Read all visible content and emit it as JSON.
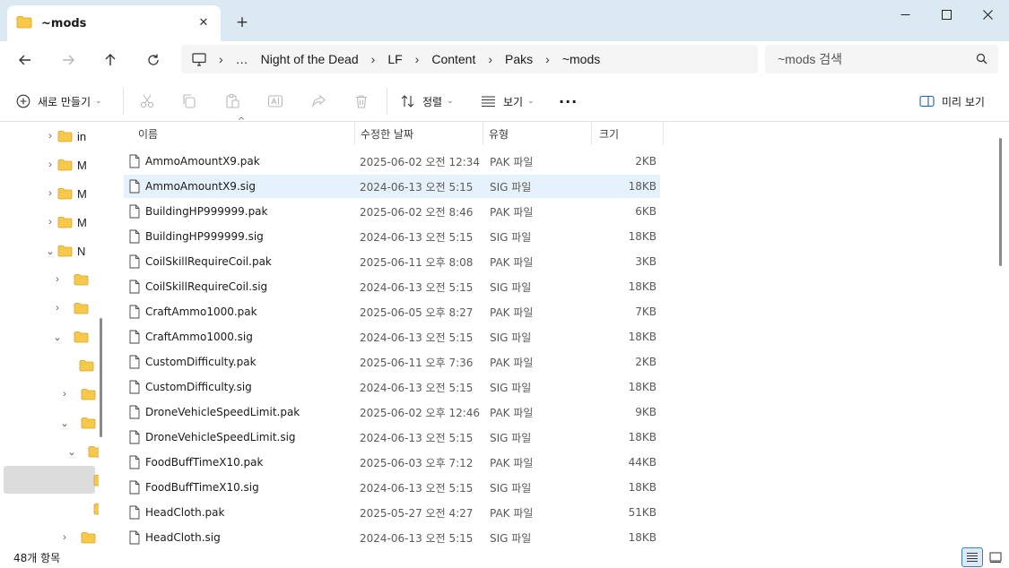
{
  "window": {
    "tab_title": "~mods",
    "new_tab": "+",
    "minimize": "—",
    "maximize": "☐",
    "close": "✕"
  },
  "address": {
    "crumbs": [
      "…",
      "Night of the Dead",
      "LF",
      "Content",
      "Paks",
      "~mods"
    ],
    "search_placeholder": "~mods 검색"
  },
  "toolbar": {
    "new_label": "새로 만들기",
    "sort_label": "정렬",
    "view_label": "보기",
    "more_label": "···",
    "preview_label": "미리 보기"
  },
  "nav_tree": [
    {
      "label": "in",
      "chevron": "›"
    },
    {
      "label": "M",
      "chevron": "›"
    },
    {
      "label": "M",
      "chevron": "›"
    },
    {
      "label": "M",
      "chevron": "›"
    },
    {
      "label": "N",
      "chevron": "⌄"
    },
    {
      "label": "",
      "chevron": "›"
    },
    {
      "label": "",
      "chevron": "›"
    },
    {
      "label": "",
      "chevron": "⌄"
    },
    {
      "label": "",
      "chevron": ""
    },
    {
      "label": "",
      "chevron": "›"
    },
    {
      "label": "",
      "chevron": "⌄"
    },
    {
      "label": "",
      "chevron": "⌄"
    },
    {
      "label": "",
      "chevron": ""
    },
    {
      "label": "",
      "chevron": ""
    },
    {
      "label": "",
      "chevron": "›"
    }
  ],
  "columns": {
    "name": "이름",
    "date": "수정한 날짜",
    "type": "유형",
    "size": "크기"
  },
  "files": [
    {
      "name": "AmmoAmountX9.pak",
      "date": "2025-06-02 오전 12:34",
      "type": "PAK 파일",
      "size": "2KB"
    },
    {
      "name": "AmmoAmountX9.sig",
      "date": "2024-06-13 오전 5:15",
      "type": "SIG 파일",
      "size": "18KB"
    },
    {
      "name": "BuildingHP999999.pak",
      "date": "2025-06-02 오전 8:46",
      "type": "PAK 파일",
      "size": "6KB"
    },
    {
      "name": "BuildingHP999999.sig",
      "date": "2024-06-13 오전 5:15",
      "type": "SIG 파일",
      "size": "18KB"
    },
    {
      "name": "CoilSkillRequireCoil.pak",
      "date": "2025-06-11 오후 8:08",
      "type": "PAK 파일",
      "size": "3KB"
    },
    {
      "name": "CoilSkillRequireCoil.sig",
      "date": "2024-06-13 오전 5:15",
      "type": "SIG 파일",
      "size": "18KB"
    },
    {
      "name": "CraftAmmo1000.pak",
      "date": "2025-06-05 오후 8:27",
      "type": "PAK 파일",
      "size": "7KB"
    },
    {
      "name": "CraftAmmo1000.sig",
      "date": "2024-06-13 오전 5:15",
      "type": "SIG 파일",
      "size": "18KB"
    },
    {
      "name": "CustomDifficulty.pak",
      "date": "2025-06-11 오후 7:36",
      "type": "PAK 파일",
      "size": "2KB"
    },
    {
      "name": "CustomDifficulty.sig",
      "date": "2024-06-13 오전 5:15",
      "type": "SIG 파일",
      "size": "18KB"
    },
    {
      "name": "DroneVehicleSpeedLimit.pak",
      "date": "2025-06-02 오후 12:46",
      "type": "PAK 파일",
      "size": "9KB"
    },
    {
      "name": "DroneVehicleSpeedLimit.sig",
      "date": "2024-06-13 오전 5:15",
      "type": "SIG 파일",
      "size": "18KB"
    },
    {
      "name": "FoodBuffTimeX10.pak",
      "date": "2025-06-03 오후 7:12",
      "type": "PAK 파일",
      "size": "44KB"
    },
    {
      "name": "FoodBuffTimeX10.sig",
      "date": "2024-06-13 오전 5:15",
      "type": "SIG 파일",
      "size": "18KB"
    },
    {
      "name": "HeadCloth.pak",
      "date": "2025-05-27 오전 4:27",
      "type": "PAK 파일",
      "size": "51KB"
    },
    {
      "name": "HeadCloth.sig",
      "date": "2024-06-13 오전 5:15",
      "type": "SIG 파일",
      "size": "18KB"
    }
  ],
  "selected_file": "AmmoAmountX9.sig",
  "status": {
    "item_count": "48개 항목"
  },
  "colors": {
    "titlebar": "#dbe9f2",
    "folder": "#f6c94a",
    "selection": "#e5f1fb",
    "accent": "#3c7fb1"
  }
}
